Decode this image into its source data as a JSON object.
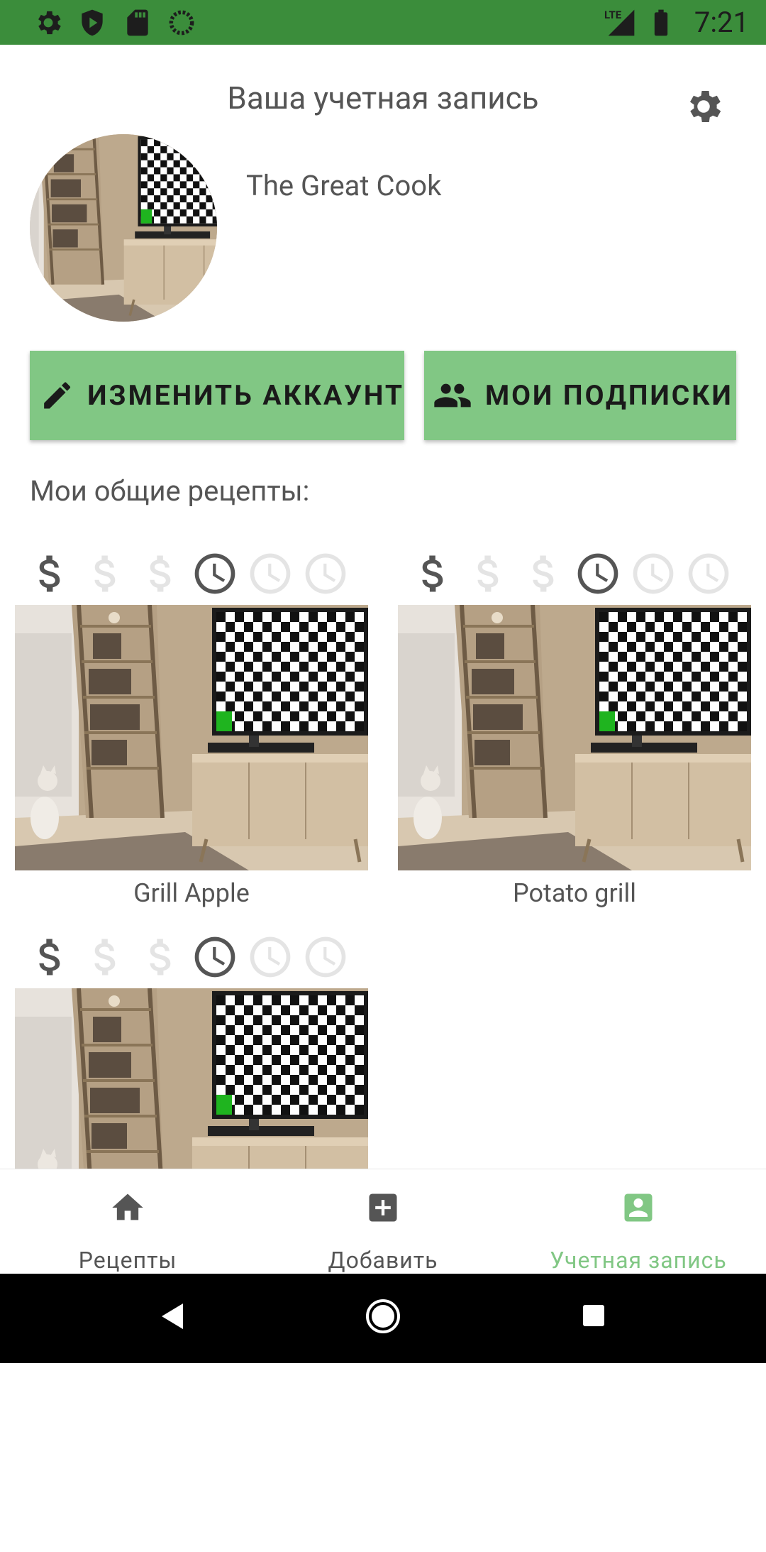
{
  "status_bar": {
    "time": "7:21",
    "network": "LTE",
    "left_icons": [
      "settings-icon",
      "shield-play-icon",
      "sd-card-icon",
      "circle-dotted-icon"
    ],
    "right_icons": [
      "lte-signal-icon",
      "battery-icon"
    ],
    "bg_color": "#3b8d3b"
  },
  "header": {
    "title": "Ваша учетная запись",
    "settings_icon": "gear-icon"
  },
  "profile": {
    "username": "The Great Cook",
    "avatar_icon": "avatar-photo"
  },
  "actions": {
    "edit_label": "ИЗМЕНИТЬ АККАУНТ",
    "edit_icon": "pencil-icon",
    "subscriptions_label": "МОИ ПОДПИСКИ",
    "subscriptions_icon": "people-icon",
    "button_color": "#81c784"
  },
  "recipes_section": {
    "title": "Мои общие рецепты:",
    "recipes": [
      {
        "title": "Grill Apple",
        "cost_level": 1,
        "cost_max": 3,
        "time_level": 1,
        "time_max": 3
      },
      {
        "title": "Potato grill",
        "cost_level": 1,
        "cost_max": 3,
        "time_level": 1,
        "time_max": 3
      },
      {
        "title": "",
        "cost_level": 1,
        "cost_max": 3,
        "time_level": 1,
        "time_max": 3
      }
    ]
  },
  "bottom_nav": {
    "items": [
      {
        "label": "Рецепты",
        "icon": "home-icon",
        "active": false
      },
      {
        "label": "Добавить",
        "icon": "add-box-icon",
        "active": false
      },
      {
        "label": "Учетная запись",
        "icon": "account-box-icon",
        "active": true
      }
    ],
    "active_color": "#81c784",
    "inactive_color": "#555555"
  },
  "system_nav": {
    "buttons": [
      "back-icon",
      "home-circle-icon",
      "recents-icon"
    ]
  }
}
